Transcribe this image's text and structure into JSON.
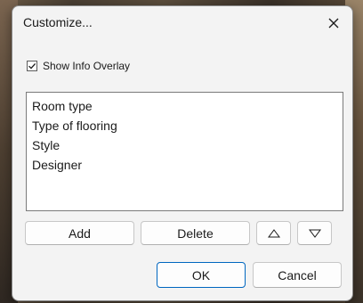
{
  "dialog": {
    "title": "Customize...",
    "close_icon": "close-icon"
  },
  "overlay_option": {
    "label": "Show Info Overlay",
    "checked": true
  },
  "list": {
    "items": [
      "Room type",
      "Type of flooring",
      "Style",
      "Designer"
    ]
  },
  "actions": {
    "add_label": "Add",
    "delete_label": "Delete",
    "move_up_icon": "triangle-up-icon",
    "move_down_icon": "triangle-down-icon"
  },
  "footer": {
    "ok_label": "OK",
    "cancel_label": "Cancel"
  },
  "colors": {
    "dialog_bg": "#f3f3f3",
    "default_button_border": "#0067c0"
  }
}
